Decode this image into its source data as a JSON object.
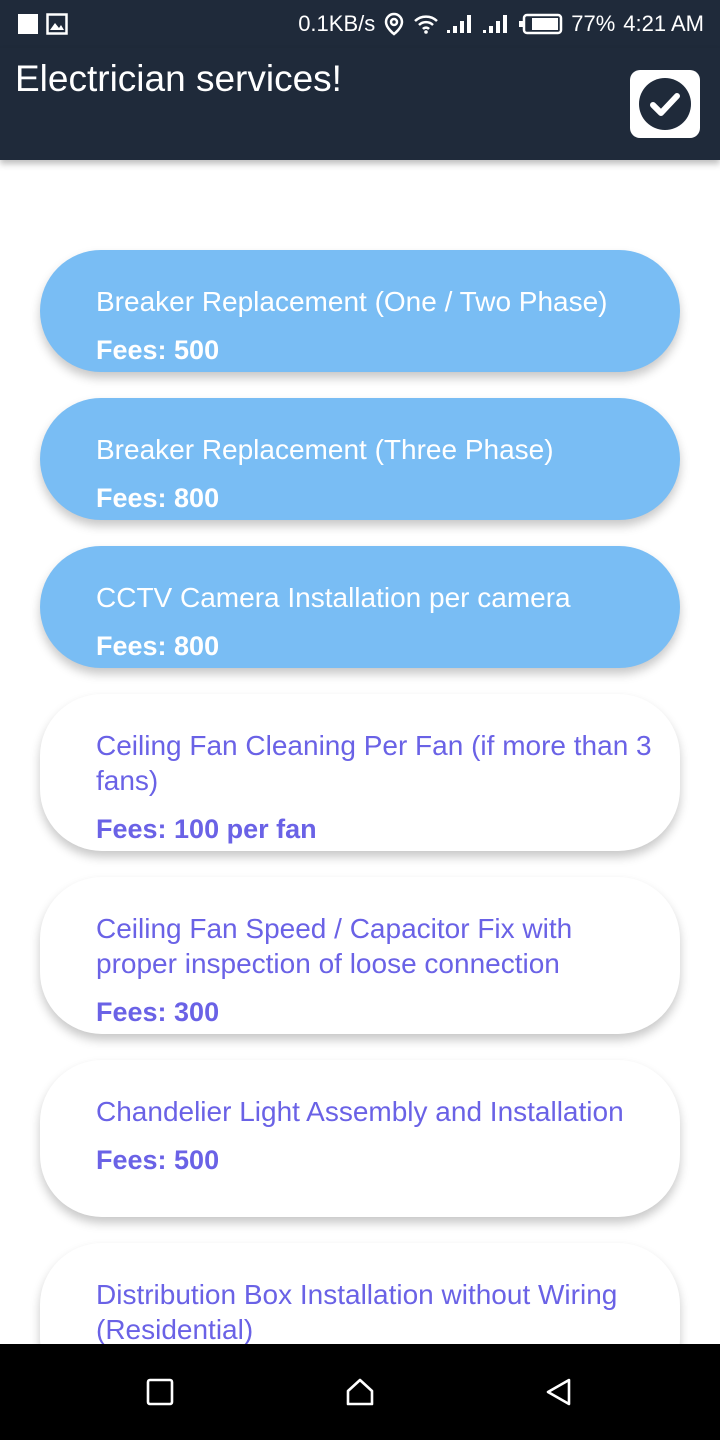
{
  "status_bar": {
    "network_speed": "0.1KB/s",
    "battery": "77%",
    "time": "4:21 AM"
  },
  "app_bar": {
    "title": "Electrician services!"
  },
  "services": [
    {
      "title": "Breaker Replacement (One / Two Phase)",
      "fee": "Fees: 500",
      "selected": true
    },
    {
      "title": "Breaker Replacement (Three Phase)",
      "fee": "Fees: 800",
      "selected": true
    },
    {
      "title": "CCTV Camera Installation per camera",
      "fee": "Fees: 800",
      "selected": true
    },
    {
      "title": "Ceiling Fan Cleaning Per Fan (if more than 3 fans)",
      "fee": "Fees: 100 per fan",
      "selected": false
    },
    {
      "title": "Ceiling Fan Speed / Capacitor Fix with proper inspection of loose connection",
      "fee": "Fees: 300",
      "selected": false
    },
    {
      "title": "Chandelier Light Assembly and Installation",
      "fee": "Fees: 500",
      "selected": false
    },
    {
      "title": "Distribution Box Installation without Wiring (Residential)",
      "fee": "",
      "selected": false
    }
  ],
  "colors": {
    "app_bar": "#1f2a3a",
    "selected_card": "#79bdf4",
    "unselected_text": "#6a62e6"
  },
  "icons": {
    "confirm": "check-circle-icon",
    "nav_recents": "square-icon",
    "nav_home": "home-icon",
    "nav_back": "back-triangle-icon"
  }
}
